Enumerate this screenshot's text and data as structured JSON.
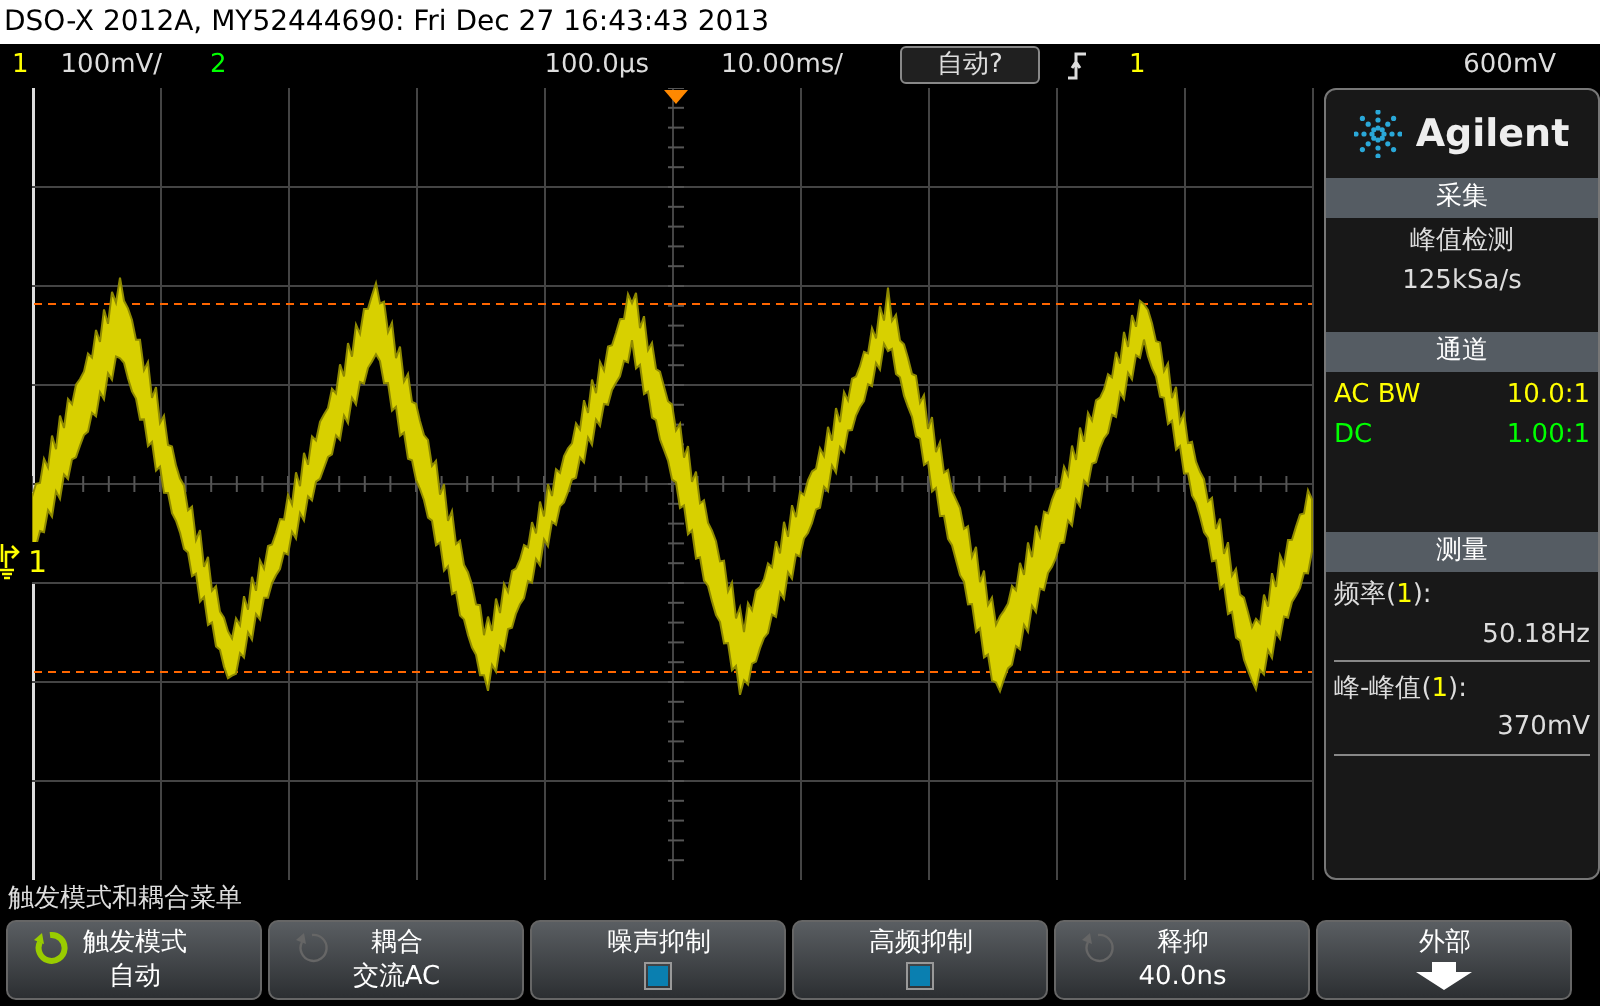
{
  "window": {
    "title": "DSO-X 2012A, MY52444690: Fri Dec 27 16:43:43 2013"
  },
  "status_bar": {
    "channels": [
      {
        "number": "1",
        "scale": "100mV/",
        "color": "#ffff00"
      },
      {
        "number": "2",
        "color": "#00ff00"
      }
    ],
    "delay": "100.0µs",
    "timebase": "10.00ms/",
    "trigger_mode_button": "自动?",
    "trigger_source": "1",
    "trigger_level": "600mV"
  },
  "display": {
    "channel_marker": "1"
  },
  "side_panel": {
    "logo": "Agilent",
    "acquisition": {
      "header": "采集",
      "mode": "峰值检测",
      "sample_rate": "125kSa/s"
    },
    "channels": {
      "header": "通道",
      "rows": [
        {
          "label": "AC BW",
          "value": "10.0:1",
          "color": "#ffff00"
        },
        {
          "label": "DC",
          "value": "1.00:1",
          "color": "#00ff00"
        }
      ]
    },
    "measurements": {
      "header": "测量",
      "items": [
        {
          "label_prefix": "频率(",
          "source": "1",
          "label_suffix": "):",
          "value": "50.18Hz"
        },
        {
          "label_prefix": "峰-峰值(",
          "source": "1",
          "label_suffix": "):",
          "value": "370mV"
        }
      ]
    }
  },
  "menu_title": "触发模式和耦合菜单",
  "softkeys": [
    {
      "kind": "value",
      "label": "触发模式",
      "value": "自动",
      "knob_active": true
    },
    {
      "kind": "value",
      "label": "耦合",
      "value": "交流AC",
      "knob_active": false
    },
    {
      "kind": "checkbox",
      "label": "噪声抑制",
      "checked": false
    },
    {
      "kind": "checkbox",
      "label": "高频抑制",
      "checked": false
    },
    {
      "kind": "value",
      "label": "释抑",
      "value": "40.0ns",
      "knob_active": false
    },
    {
      "kind": "arrow",
      "label": "外部"
    }
  ]
}
